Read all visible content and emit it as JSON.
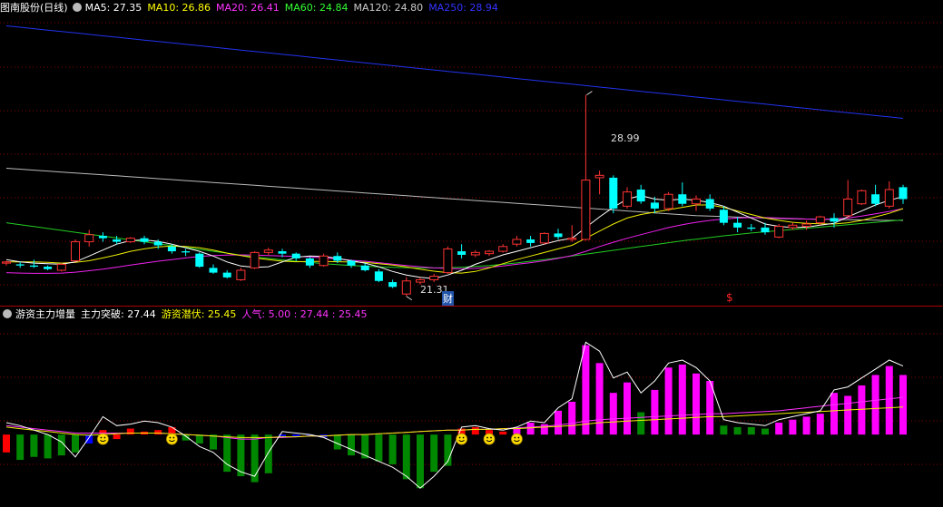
{
  "main": {
    "title": "图南股份(日线)",
    "ma": [
      {
        "label": "MA5: 27.35",
        "color": "#ffffff"
      },
      {
        "label": "MA10: 26.86",
        "color": "#ffff00"
      },
      {
        "label": "MA20: 26.41",
        "color": "#ff33ff"
      },
      {
        "label": "MA60: 24.84",
        "color": "#33ff33"
      },
      {
        "label": "MA120: 24.80",
        "color": "#cccccc"
      },
      {
        "label": "MA250: 28.94",
        "color": "#3333ff"
      }
    ],
    "high_label": "28.99",
    "low_label": "21.31",
    "marker_cai": "财",
    "marker_s": "$"
  },
  "sub": {
    "title": "游资主力增量",
    "items": [
      {
        "label": "主力突破: 27.44",
        "color": "#ffffff"
      },
      {
        "label": "游资潜伏: 25.45",
        "color": "#ffff00"
      },
      {
        "label": "人气: 5.00 : 27.44 : 25.45",
        "color": "#ff33ff"
      }
    ]
  },
  "colors": {
    "up": "#ff3333",
    "down": "#00ffff",
    "grid": "#8b0000",
    "bar_magenta": "#ff00ff",
    "bar_green": "#007700",
    "bar_blue": "#0000ff"
  },
  "candles": [
    [
      21.9,
      22.0,
      21.8,
      21.95
    ],
    [
      21.85,
      21.95,
      21.7,
      21.8
    ],
    [
      21.8,
      22.05,
      21.7,
      21.75
    ],
    [
      21.75,
      21.8,
      21.6,
      21.65
    ],
    [
      21.6,
      21.9,
      21.55,
      21.85
    ],
    [
      22.0,
      22.9,
      21.95,
      22.8
    ],
    [
      22.8,
      23.3,
      22.6,
      23.1
    ],
    [
      23.05,
      23.2,
      22.8,
      22.95
    ],
    [
      22.9,
      23.05,
      22.7,
      22.8
    ],
    [
      22.8,
      23.0,
      22.75,
      22.95
    ],
    [
      22.95,
      23.05,
      22.7,
      22.8
    ],
    [
      22.8,
      22.9,
      22.5,
      22.65
    ],
    [
      22.6,
      22.7,
      22.3,
      22.4
    ],
    [
      22.4,
      22.5,
      22.2,
      22.35
    ],
    [
      22.3,
      22.35,
      21.7,
      21.75
    ],
    [
      21.7,
      21.85,
      21.45,
      21.5
    ],
    [
      21.5,
      21.6,
      21.25,
      21.3
    ],
    [
      21.2,
      21.7,
      21.15,
      21.6
    ],
    [
      21.7,
      22.4,
      21.65,
      22.35
    ],
    [
      22.35,
      22.55,
      22.25,
      22.45
    ],
    [
      22.4,
      22.5,
      22.15,
      22.3
    ],
    [
      22.3,
      22.35,
      22.0,
      22.1
    ],
    [
      22.1,
      22.15,
      21.7,
      21.8
    ],
    [
      21.8,
      22.3,
      21.75,
      22.2
    ],
    [
      22.2,
      22.35,
      21.9,
      22.0
    ],
    [
      22.0,
      22.05,
      21.7,
      21.8
    ],
    [
      21.8,
      21.9,
      21.55,
      21.6
    ],
    [
      21.55,
      21.65,
      21.1,
      21.15
    ],
    [
      21.1,
      21.2,
      20.85,
      20.9
    ],
    [
      20.6,
      21.31,
      20.5,
      21.15
    ],
    [
      21.1,
      21.3,
      21.0,
      21.2
    ],
    [
      21.2,
      21.45,
      21.1,
      21.35
    ],
    [
      21.5,
      22.6,
      21.45,
      22.5
    ],
    [
      22.4,
      22.7,
      22.1,
      22.25
    ],
    [
      22.25,
      22.45,
      22.15,
      22.35
    ],
    [
      22.3,
      22.45,
      22.2,
      22.4
    ],
    [
      22.4,
      22.7,
      22.35,
      22.6
    ],
    [
      22.7,
      23.05,
      22.6,
      22.9
    ],
    [
      22.9,
      23.05,
      22.6,
      22.75
    ],
    [
      22.75,
      23.2,
      22.7,
      23.15
    ],
    [
      23.15,
      23.35,
      22.9,
      23.0
    ],
    [
      22.9,
      23.5,
      22.8,
      22.95
    ],
    [
      22.9,
      28.99,
      22.85,
      25.4
    ],
    [
      25.5,
      25.8,
      24.8,
      25.6
    ],
    [
      25.5,
      25.6,
      24.0,
      24.2
    ],
    [
      24.3,
      25.1,
      24.2,
      24.9
    ],
    [
      25.0,
      25.2,
      24.4,
      24.5
    ],
    [
      24.45,
      24.7,
      24.0,
      24.2
    ],
    [
      24.2,
      24.9,
      24.1,
      24.8
    ],
    [
      24.8,
      25.3,
      24.3,
      24.4
    ],
    [
      24.4,
      24.75,
      24.1,
      24.6
    ],
    [
      24.6,
      24.8,
      24.1,
      24.2
    ],
    [
      24.15,
      24.3,
      23.5,
      23.6
    ],
    [
      23.6,
      23.85,
      23.2,
      23.4
    ],
    [
      23.4,
      23.55,
      23.25,
      23.35
    ],
    [
      23.4,
      23.6,
      23.1,
      23.2
    ],
    [
      23.0,
      23.55,
      22.95,
      23.45
    ],
    [
      23.4,
      23.6,
      23.3,
      23.5
    ],
    [
      23.45,
      23.7,
      23.3,
      23.55
    ],
    [
      23.6,
      23.9,
      23.5,
      23.85
    ],
    [
      23.8,
      24.0,
      23.4,
      23.65
    ],
    [
      23.9,
      25.4,
      23.8,
      24.6
    ],
    [
      24.4,
      25.0,
      24.35,
      24.95
    ],
    [
      24.8,
      25.2,
      24.3,
      24.4
    ],
    [
      24.3,
      25.35,
      24.2,
      25.0
    ],
    [
      25.1,
      25.2,
      24.4,
      24.6
    ]
  ],
  "ma_series": {
    "ma5": [
      22.05,
      21.95,
      21.9,
      21.88,
      21.85,
      21.95,
      22.2,
      22.45,
      22.7,
      22.85,
      22.88,
      22.82,
      22.7,
      22.55,
      22.4,
      22.2,
      21.95,
      21.78,
      21.72,
      21.75,
      21.95,
      22.15,
      22.2,
      22.18,
      22.1,
      22.0,
      21.9,
      21.75,
      21.55,
      21.4,
      21.3,
      21.25,
      21.4,
      21.6,
      21.85,
      22.05,
      22.25,
      22.4,
      22.55,
      22.7,
      22.85,
      22.95,
      23.4,
      23.85,
      24.25,
      24.6,
      24.75,
      24.6,
      24.55,
      24.6,
      24.55,
      24.45,
      24.3,
      24.05,
      23.8,
      23.55,
      23.45,
      23.4,
      23.42,
      23.5,
      23.58,
      23.85,
      24.1,
      24.35,
      24.55,
      24.7
    ],
    "ma10": [
      21.95,
      21.95,
      21.95,
      21.93,
      21.9,
      21.93,
      22.0,
      22.12,
      22.25,
      22.4,
      22.5,
      22.58,
      22.62,
      22.6,
      22.55,
      22.45,
      22.32,
      22.22,
      22.12,
      22.05,
      21.98,
      21.96,
      21.97,
      21.97,
      21.96,
      21.95,
      21.93,
      21.88,
      21.82,
      21.74,
      21.64,
      21.56,
      21.5,
      21.48,
      21.55,
      21.7,
      21.88,
      22.05,
      22.2,
      22.35,
      22.5,
      22.65,
      22.95,
      23.25,
      23.55,
      23.8,
      23.95,
      24.05,
      24.15,
      24.25,
      24.35,
      24.35,
      24.25,
      24.1,
      23.95,
      23.8,
      23.7,
      23.62,
      23.58,
      23.56,
      23.55,
      23.6,
      23.7,
      23.85,
      24.0,
      24.2
    ],
    "ma20": [
      21.5,
      21.48,
      21.47,
      21.47,
      21.48,
      21.52,
      21.58,
      21.65,
      21.73,
      21.82,
      21.9,
      21.98,
      22.05,
      22.12,
      22.18,
      22.22,
      22.24,
      22.25,
      22.24,
      22.22,
      22.2,
      22.18,
      22.16,
      22.12,
      22.08,
      22.02,
      21.98,
      21.92,
      21.86,
      21.8,
      21.75,
      21.7,
      21.68,
      21.66,
      21.68,
      21.72,
      21.78,
      21.85,
      21.92,
      22.0,
      22.1,
      22.22,
      22.4,
      22.6,
      22.78,
      22.95,
      23.1,
      23.25,
      23.4,
      23.52,
      23.62,
      23.7,
      23.76,
      23.8,
      23.82,
      23.82,
      23.8,
      23.78,
      23.76,
      23.75,
      23.76,
      23.8,
      23.88,
      23.98,
      24.08,
      24.2
    ],
    "ma60": [
      23.6,
      23.52,
      23.44,
      23.36,
      23.28,
      23.2,
      23.12,
      23.04,
      22.96,
      22.88,
      22.8,
      22.72,
      22.64,
      22.56,
      22.48,
      22.4,
      22.32,
      22.24,
      22.16,
      22.1,
      22.04,
      21.98,
      21.93,
      21.88,
      21.84,
      21.8,
      21.77,
      21.74,
      21.72,
      21.71,
      21.7,
      21.7,
      21.71,
      21.73,
      21.76,
      21.8,
      21.85,
      21.91,
      21.98,
      22.05,
      22.12,
      22.2,
      22.28,
      22.36,
      22.44,
      22.52,
      22.6,
      22.68,
      22.76,
      22.84,
      22.91,
      22.98,
      23.05,
      23.11,
      23.17,
      23.22,
      23.27,
      23.32,
      23.37,
      23.42,
      23.47,
      23.52,
      23.57,
      23.62,
      23.67,
      23.72
    ],
    "ma120": [
      25.9,
      25.86,
      25.82,
      25.78,
      25.74,
      25.7,
      25.66,
      25.62,
      25.58,
      25.54,
      25.5,
      25.46,
      25.42,
      25.38,
      25.34,
      25.3,
      25.26,
      25.22,
      25.18,
      25.14,
      25.1,
      25.06,
      25.02,
      24.98,
      24.94,
      24.9,
      24.86,
      24.82,
      24.78,
      24.74,
      24.7,
      24.66,
      24.62,
      24.58,
      24.54,
      24.5,
      24.46,
      24.42,
      24.38,
      24.34,
      24.3,
      24.26,
      24.22,
      24.18,
      24.14,
      24.1,
      24.06,
      24.02,
      23.98,
      23.94,
      23.9,
      23.88,
      23.86,
      23.84,
      23.82,
      23.8,
      23.78,
      23.77,
      23.76,
      23.75,
      23.74,
      23.73,
      23.72,
      23.71,
      23.7,
      23.7
    ],
    "ma250": [
      31.9,
      31.84,
      31.78,
      31.72,
      31.66,
      31.6,
      31.54,
      31.48,
      31.42,
      31.36,
      31.3,
      31.24,
      31.18,
      31.12,
      31.06,
      31.0,
      30.94,
      30.88,
      30.82,
      30.76,
      30.7,
      30.64,
      30.58,
      30.52,
      30.46,
      30.4,
      30.34,
      30.28,
      30.22,
      30.16,
      30.1,
      30.04,
      29.98,
      29.92,
      29.86,
      29.8,
      29.74,
      29.68,
      29.62,
      29.56,
      29.5,
      29.44,
      29.38,
      29.32,
      29.26,
      29.2,
      29.14,
      29.08,
      29.02,
      28.96,
      28.9,
      28.84,
      28.78,
      28.72,
      28.66,
      28.6,
      28.54,
      28.48,
      28.42,
      28.36,
      28.3,
      28.24,
      28.18,
      28.12,
      28.06,
      28.0
    ]
  },
  "osc": {
    "bars": [
      -1.2,
      -1.7,
      -1.5,
      -1.6,
      -1.4,
      -1.2,
      -0.6,
      0.3,
      -0.3,
      0.4,
      0.2,
      0.3,
      0.5,
      -0.4,
      -0.6,
      -1.0,
      -2.5,
      -2.8,
      -3.2,
      -2.6,
      -0.2,
      -0.1,
      -0.1,
      -0.2,
      -1.0,
      -1.4,
      -1.6,
      -1.8,
      -2.0,
      -3.0,
      -3.6,
      -2.5,
      -2.1,
      0.4,
      0.5,
      0.3,
      0.2,
      0.4,
      0.8,
      0.7,
      1.6,
      2.2,
      6.0,
      4.8,
      2.8,
      3.5,
      1.5,
      3.0,
      4.5,
      4.7,
      4.1,
      3.6,
      0.6,
      0.5,
      0.5,
      0.4,
      0.8,
      1.0,
      1.2,
      1.4,
      2.8,
      2.6,
      3.3,
      4.0,
      4.6,
      4.0
    ],
    "colors": [
      "R",
      "G",
      "G",
      "G",
      "G",
      "G",
      "B",
      "R",
      "R",
      "R",
      "R",
      "R",
      "R",
      "G",
      "G",
      "G",
      "G",
      "G",
      "G",
      "G",
      "B",
      "B",
      "B",
      "B",
      "G",
      "G",
      "G",
      "G",
      "G",
      "G",
      "G",
      "G",
      "G",
      "R",
      "R",
      "R",
      "R",
      "M",
      "M",
      "M",
      "M",
      "M",
      "M",
      "M",
      "M",
      "M",
      "G",
      "M",
      "M",
      "M",
      "M",
      "M",
      "G",
      "G",
      "G",
      "G",
      "M",
      "M",
      "M",
      "M",
      "M",
      "M",
      "M",
      "M",
      "M",
      "M"
    ],
    "zero_value": 0,
    "range": [
      -4.5,
      7.5
    ],
    "line_white": [
      0.8,
      0.6,
      0.3,
      0.0,
      -0.5,
      -1.5,
      -0.2,
      1.2,
      0.6,
      0.7,
      0.9,
      0.8,
      0.5,
      -0.1,
      -0.8,
      -1.2,
      -2.0,
      -2.5,
      -2.8,
      -1.2,
      0.2,
      0.1,
      0.0,
      -0.2,
      -0.6,
      -1.0,
      -1.4,
      -1.8,
      -2.2,
      -2.8,
      -3.6,
      -2.8,
      -1.8,
      0.5,
      0.6,
      0.4,
      0.3,
      0.5,
      0.9,
      0.8,
      1.8,
      2.4,
      6.2,
      5.6,
      3.8,
      4.2,
      2.8,
      3.6,
      4.8,
      5.0,
      4.5,
      3.6,
      1.0,
      0.8,
      0.7,
      0.6,
      1.0,
      1.2,
      1.4,
      1.6,
      3.0,
      3.2,
      3.8,
      4.4,
      5.0,
      4.6
    ],
    "line_yellow": [
      0.5,
      0.4,
      0.3,
      0.2,
      0.1,
      0.0,
      -0.05,
      0.0,
      0.05,
      0.1,
      0.1,
      0.1,
      0.05,
      0.0,
      -0.05,
      -0.1,
      -0.15,
      -0.2,
      -0.2,
      -0.2,
      -0.15,
      -0.15,
      -0.1,
      -0.1,
      -0.05,
      0.0,
      0.0,
      0.05,
      0.1,
      0.15,
      0.2,
      0.25,
      0.3,
      0.3,
      0.35,
      0.35,
      0.4,
      0.4,
      0.45,
      0.5,
      0.55,
      0.6,
      0.7,
      0.8,
      0.85,
      0.9,
      0.95,
      1.0,
      1.05,
      1.1,
      1.15,
      1.2,
      1.2,
      1.25,
      1.3,
      1.35,
      1.4,
      1.45,
      1.5,
      1.55,
      1.6,
      1.65,
      1.7,
      1.75,
      1.8,
      1.85
    ],
    "line_magenta": [
      0.6,
      0.5,
      0.4,
      0.3,
      0.2,
      0.1,
      0.1,
      0.1,
      0.1,
      0.1,
      0.1,
      0.1,
      0.05,
      0.0,
      -0.05,
      -0.1,
      -0.2,
      -0.3,
      -0.3,
      -0.2,
      -0.2,
      -0.15,
      -0.1,
      -0.1,
      -0.05,
      0.0,
      0.0,
      0.05,
      0.1,
      0.15,
      0.2,
      0.25,
      0.3,
      0.3,
      0.35,
      0.35,
      0.4,
      0.45,
      0.5,
      0.55,
      0.65,
      0.75,
      0.9,
      1.0,
      1.05,
      1.1,
      1.15,
      1.2,
      1.25,
      1.3,
      1.35,
      1.4,
      1.4,
      1.45,
      1.5,
      1.55,
      1.6,
      1.7,
      1.8,
      1.9,
      2.0,
      2.1,
      2.2,
      2.3,
      2.4,
      2.5
    ],
    "smiley_indices": [
      7,
      12,
      33,
      35,
      37
    ]
  }
}
